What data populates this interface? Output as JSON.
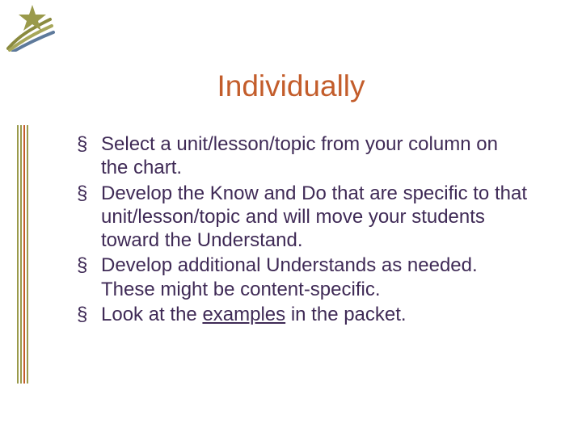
{
  "title": "Individually",
  "bullets": [
    "Select a unit/lesson/topic from your column on the chart.",
    "Develop the Know and Do that are specific to that unit/lesson/topic and will move your students toward the Understand.",
    "Develop additional Understands as needed. These might be content-specific."
  ],
  "bullet4": {
    "pre": "Look at the ",
    "link": "examples",
    "post": " in the packet."
  },
  "colors": {
    "accent": "#c35d2b",
    "text": "#3f2a56",
    "rule_olive": "#9a9a4b",
    "rule_orange": "#c35d2b"
  }
}
